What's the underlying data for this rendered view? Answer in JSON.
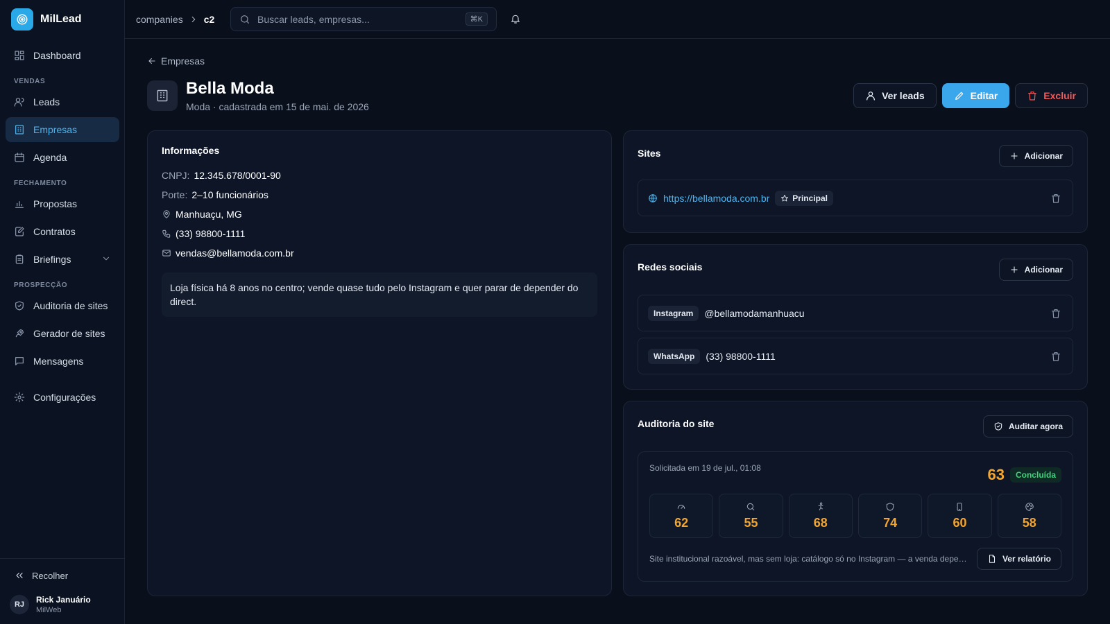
{
  "app": {
    "name": "MilLead"
  },
  "sidebar": {
    "dashboard": "Dashboard",
    "sections": {
      "vendas": "VENDAS",
      "fechamento": "FECHAMENTO",
      "prospeccao": "PROSPECÇÃO"
    },
    "items": {
      "leads": "Leads",
      "empresas": "Empresas",
      "agenda": "Agenda",
      "propostas": "Propostas",
      "contratos": "Contratos",
      "briefings": "Briefings",
      "auditoria": "Auditoria de sites",
      "gerador": "Gerador de sites",
      "mensagens": "Mensagens",
      "configuracoes": "Configurações"
    },
    "active": "empresas",
    "collapse_label": "Recolher",
    "user": {
      "initials": "RJ",
      "name": "Rick Januário",
      "org": "MilWeb"
    }
  },
  "topbar": {
    "breadcrumb": [
      "companies",
      "c2"
    ],
    "search_placeholder": "Buscar leads, empresas...",
    "search_shortcut": "⌘K"
  },
  "company": {
    "back_label": "Empresas",
    "name": "Bella Moda",
    "subtitle": "Moda · cadastrada em 15 de mai. de 2026",
    "actions": {
      "leads": "Ver leads",
      "edit": "Editar",
      "delete": "Excluir"
    }
  },
  "info": {
    "title": "Informações",
    "cnpj_label": "CNPJ:",
    "cnpj": "12.345.678/0001-90",
    "porte_label": "Porte:",
    "porte": "2–10 funcionários",
    "location": "Manhuaçu, MG",
    "phone": "(33) 98800-1111",
    "email": "vendas@bellamoda.com.br",
    "note": "Loja física há 8 anos no centro; vende quase tudo pelo Instagram e quer parar de depender do direct."
  },
  "sites": {
    "title": "Sites",
    "add_label": "Adicionar",
    "items": [
      {
        "url": "https://bellamoda.com.br",
        "badge": "Principal"
      }
    ]
  },
  "social": {
    "title": "Redes sociais",
    "add_label": "Adicionar",
    "items": [
      {
        "network": "Instagram",
        "handle": "@bellamodamanhuacu"
      },
      {
        "network": "WhatsApp",
        "handle": "(33) 98800-1111"
      }
    ]
  },
  "audit": {
    "title": "Auditoria do site",
    "run_label": "Auditar agora",
    "requested": "Solicitada em 19 de jul., 01:08",
    "score": "63",
    "status": "Concluída",
    "metrics": [
      {
        "icon": "gauge-icon",
        "value": "62"
      },
      {
        "icon": "search-icon",
        "value": "55"
      },
      {
        "icon": "accessibility-icon",
        "value": "68"
      },
      {
        "icon": "shield-icon",
        "value": "74"
      },
      {
        "icon": "mobile-icon",
        "value": "60"
      },
      {
        "icon": "palette-icon",
        "value": "58"
      }
    ],
    "summary": "Site institucional razoável, mas sem loja: catálogo só no Instagram — a venda depende...",
    "report_label": "Ver relatório"
  },
  "colors": {
    "accent": "#3aa7ec",
    "danger": "#f05b5b",
    "score": "#f2a530",
    "success": "#3dd47a"
  }
}
